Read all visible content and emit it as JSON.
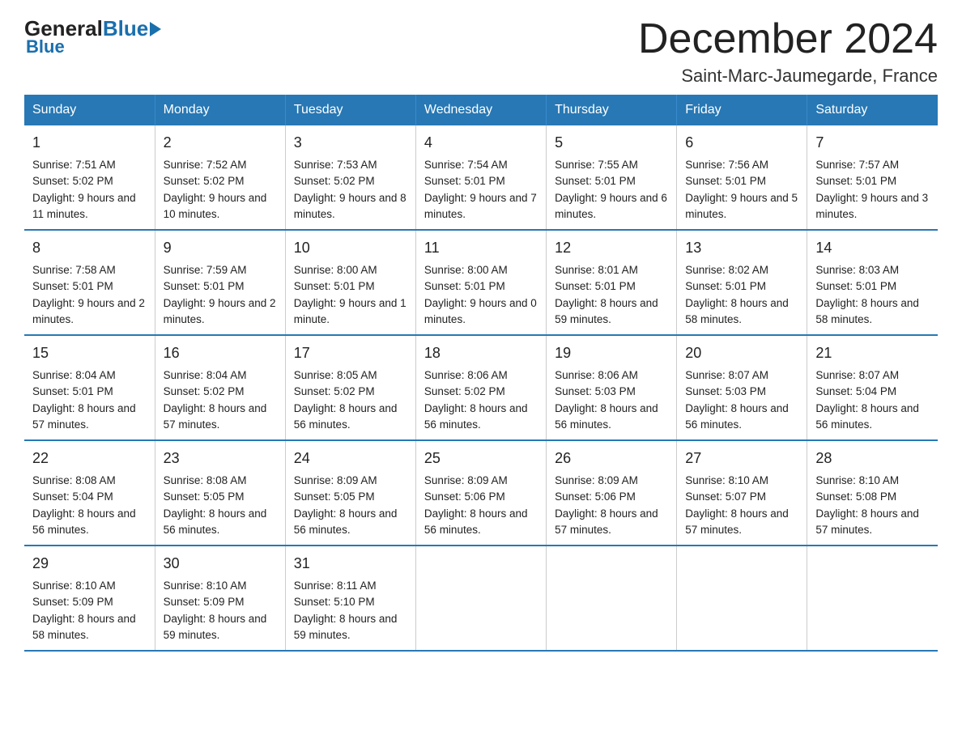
{
  "logo": {
    "general": "General",
    "blue": "Blue"
  },
  "title": "December 2024",
  "subtitle": "Saint-Marc-Jaumegarde, France",
  "days": [
    "Sunday",
    "Monday",
    "Tuesday",
    "Wednesday",
    "Thursday",
    "Friday",
    "Saturday"
  ],
  "weeks": [
    [
      {
        "day": "1",
        "sunrise": "7:51 AM",
        "sunset": "5:02 PM",
        "daylight": "9 hours and 11 minutes."
      },
      {
        "day": "2",
        "sunrise": "7:52 AM",
        "sunset": "5:02 PM",
        "daylight": "9 hours and 10 minutes."
      },
      {
        "day": "3",
        "sunrise": "7:53 AM",
        "sunset": "5:02 PM",
        "daylight": "9 hours and 8 minutes."
      },
      {
        "day": "4",
        "sunrise": "7:54 AM",
        "sunset": "5:01 PM",
        "daylight": "9 hours and 7 minutes."
      },
      {
        "day": "5",
        "sunrise": "7:55 AM",
        "sunset": "5:01 PM",
        "daylight": "9 hours and 6 minutes."
      },
      {
        "day": "6",
        "sunrise": "7:56 AM",
        "sunset": "5:01 PM",
        "daylight": "9 hours and 5 minutes."
      },
      {
        "day": "7",
        "sunrise": "7:57 AM",
        "sunset": "5:01 PM",
        "daylight": "9 hours and 3 minutes."
      }
    ],
    [
      {
        "day": "8",
        "sunrise": "7:58 AM",
        "sunset": "5:01 PM",
        "daylight": "9 hours and 2 minutes."
      },
      {
        "day": "9",
        "sunrise": "7:59 AM",
        "sunset": "5:01 PM",
        "daylight": "9 hours and 2 minutes."
      },
      {
        "day": "10",
        "sunrise": "8:00 AM",
        "sunset": "5:01 PM",
        "daylight": "9 hours and 1 minute."
      },
      {
        "day": "11",
        "sunrise": "8:00 AM",
        "sunset": "5:01 PM",
        "daylight": "9 hours and 0 minutes."
      },
      {
        "day": "12",
        "sunrise": "8:01 AM",
        "sunset": "5:01 PM",
        "daylight": "8 hours and 59 minutes."
      },
      {
        "day": "13",
        "sunrise": "8:02 AM",
        "sunset": "5:01 PM",
        "daylight": "8 hours and 58 minutes."
      },
      {
        "day": "14",
        "sunrise": "8:03 AM",
        "sunset": "5:01 PM",
        "daylight": "8 hours and 58 minutes."
      }
    ],
    [
      {
        "day": "15",
        "sunrise": "8:04 AM",
        "sunset": "5:01 PM",
        "daylight": "8 hours and 57 minutes."
      },
      {
        "day": "16",
        "sunrise": "8:04 AM",
        "sunset": "5:02 PM",
        "daylight": "8 hours and 57 minutes."
      },
      {
        "day": "17",
        "sunrise": "8:05 AM",
        "sunset": "5:02 PM",
        "daylight": "8 hours and 56 minutes."
      },
      {
        "day": "18",
        "sunrise": "8:06 AM",
        "sunset": "5:02 PM",
        "daylight": "8 hours and 56 minutes."
      },
      {
        "day": "19",
        "sunrise": "8:06 AM",
        "sunset": "5:03 PM",
        "daylight": "8 hours and 56 minutes."
      },
      {
        "day": "20",
        "sunrise": "8:07 AM",
        "sunset": "5:03 PM",
        "daylight": "8 hours and 56 minutes."
      },
      {
        "day": "21",
        "sunrise": "8:07 AM",
        "sunset": "5:04 PM",
        "daylight": "8 hours and 56 minutes."
      }
    ],
    [
      {
        "day": "22",
        "sunrise": "8:08 AM",
        "sunset": "5:04 PM",
        "daylight": "8 hours and 56 minutes."
      },
      {
        "day": "23",
        "sunrise": "8:08 AM",
        "sunset": "5:05 PM",
        "daylight": "8 hours and 56 minutes."
      },
      {
        "day": "24",
        "sunrise": "8:09 AM",
        "sunset": "5:05 PM",
        "daylight": "8 hours and 56 minutes."
      },
      {
        "day": "25",
        "sunrise": "8:09 AM",
        "sunset": "5:06 PM",
        "daylight": "8 hours and 56 minutes."
      },
      {
        "day": "26",
        "sunrise": "8:09 AM",
        "sunset": "5:06 PM",
        "daylight": "8 hours and 57 minutes."
      },
      {
        "day": "27",
        "sunrise": "8:10 AM",
        "sunset": "5:07 PM",
        "daylight": "8 hours and 57 minutes."
      },
      {
        "day": "28",
        "sunrise": "8:10 AM",
        "sunset": "5:08 PM",
        "daylight": "8 hours and 57 minutes."
      }
    ],
    [
      {
        "day": "29",
        "sunrise": "8:10 AM",
        "sunset": "5:09 PM",
        "daylight": "8 hours and 58 minutes."
      },
      {
        "day": "30",
        "sunrise": "8:10 AM",
        "sunset": "5:09 PM",
        "daylight": "8 hours and 59 minutes."
      },
      {
        "day": "31",
        "sunrise": "8:11 AM",
        "sunset": "5:10 PM",
        "daylight": "8 hours and 59 minutes."
      },
      null,
      null,
      null,
      null
    ]
  ],
  "labels": {
    "sunrise": "Sunrise:",
    "sunset": "Sunset:",
    "daylight": "Daylight:"
  }
}
